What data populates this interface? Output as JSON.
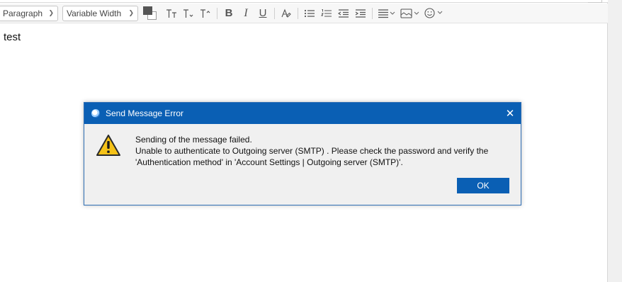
{
  "toolbar": {
    "paragraph_combo": "Paragraph",
    "font_combo": "Variable Width",
    "icons": [
      "text-color-icon",
      "smaller-text-icon",
      "normal-text-icon",
      "larger-text-icon",
      "bold-icon",
      "italic-icon",
      "underline-icon",
      "text-style-icon",
      "bulleted-list-icon",
      "numbered-list-icon",
      "outdent-icon",
      "indent-icon",
      "align-icon",
      "insert-icon",
      "emoji-icon"
    ]
  },
  "editor": {
    "text": "test"
  },
  "dialog": {
    "title": "Send Message Error",
    "lines": [
      "Sending of the message failed.",
      "Unable to authenticate to Outgoing server (SMTP) . Please check the password and verify the",
      "'Authentication method' in 'Account Settings | Outgoing server (SMTP)'."
    ],
    "ok_label": "OK",
    "titlebar_color": "#0a5fb4"
  }
}
